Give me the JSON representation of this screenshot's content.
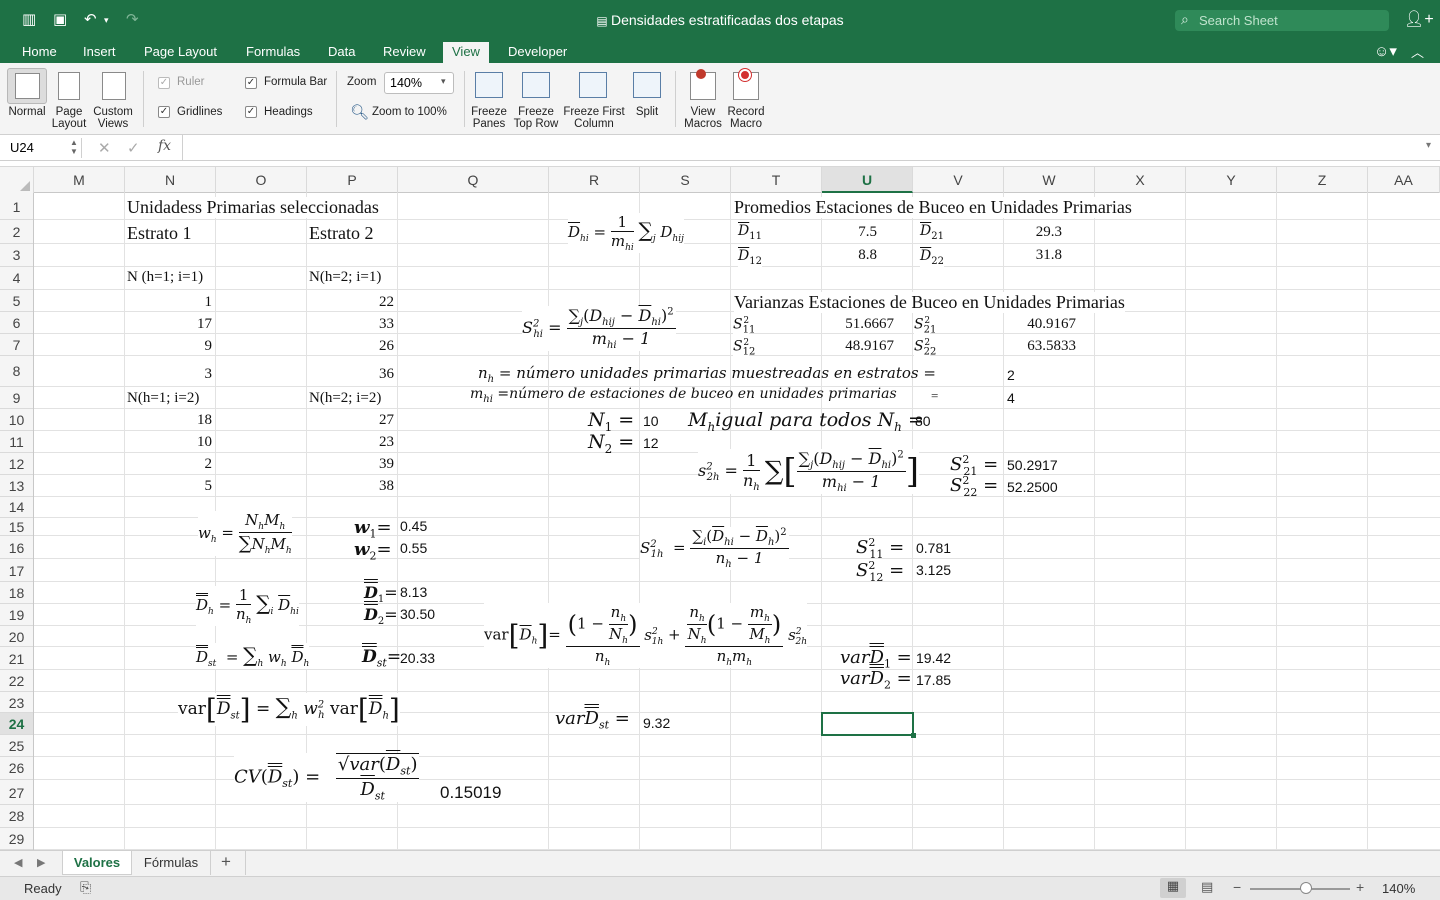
{
  "app": {
    "title": "Densidades estratificadas dos etapas",
    "search_placeholder": "Search Sheet",
    "accent": "#1e7145"
  },
  "ribbon_tabs": [
    "Home",
    "Insert",
    "Page Layout",
    "Formulas",
    "Data",
    "Review",
    "View",
    "Developer"
  ],
  "active_tab": "View",
  "ribbon": {
    "normal": "Normal",
    "page_layout": [
      "Page",
      "Layout"
    ],
    "custom_views": [
      "Custom",
      "Views"
    ],
    "ruler": "Ruler",
    "formula_bar": "Formula Bar",
    "gridlines": "Gridlines",
    "headings": "Headings",
    "zoom_label": "Zoom",
    "zoom_value": "140%",
    "zoom_100": "Zoom to 100%",
    "freeze_panes": [
      "Freeze",
      "Panes"
    ],
    "freeze_top_row": [
      "Freeze",
      "Top Row"
    ],
    "freeze_first_column": [
      "Freeze First",
      "Column"
    ],
    "split": "Split",
    "view_macros": [
      "View",
      "Macros"
    ],
    "record_macro": [
      "Record",
      "Macro"
    ]
  },
  "formula_bar": {
    "name_box": "U24",
    "fx": "fx",
    "content": ""
  },
  "columns": [
    "M",
    "N",
    "O",
    "P",
    "Q",
    "R",
    "S",
    "T",
    "U",
    "V",
    "W",
    "X",
    "Y",
    "Z",
    "AA"
  ],
  "selected_column": "U",
  "rows": [
    "1",
    "2",
    "3",
    "4",
    "5",
    "6",
    "7",
    "8",
    "9",
    "10",
    "11",
    "12",
    "13",
    "14",
    "15",
    "16",
    "17",
    "18",
    "19",
    "20",
    "21",
    "22",
    "23",
    "24",
    "25",
    "26",
    "27",
    "28",
    "29"
  ],
  "selected_row": "24",
  "cells": {
    "n1": "Unidadess Primarias seleccionadas",
    "n2": "Estrato 1",
    "p2": "Estrato 2",
    "n4": "N (h=1; i=1)",
    "p4": "N(h=2; i=1)",
    "n5": "1",
    "p5": "22",
    "n6": "17",
    "p6": "33",
    "n7": "9",
    "p7": "26",
    "n8": "3",
    "p8": "36",
    "n9": "N(h=1; i=2)",
    "p9": "N(h=2; i=2)",
    "n10": "18",
    "p10": "27",
    "n11": "10",
    "p11": "23",
    "n12": "2",
    "p12": "39",
    "n13": "5",
    "p13": "38",
    "t1": "Promedios Estaciones de Buceo en Unidades Primarias",
    "u2": "7.5",
    "w2": "29.3",
    "u3": "8.8",
    "w3": "31.8",
    "t5": "Varianzas Estaciones de Buceo en Unidades Primarias",
    "u6": "51.6667",
    "w6": "40.9167",
    "u7": "48.9167",
    "w7": "63.5833",
    "nh_text": "= número unidades primarias muestreadas en estratos =",
    "mhi_text": "=número de estaciones de buceo en unidades primarias",
    "eq_sign": "=",
    "w8": "2",
    "w9": "4",
    "s10": "10",
    "s11": "12",
    "mh_text": "igual para todos",
    "u10": "80",
    "w12": "50.2917",
    "w13": "52.2500",
    "p15": "0.45",
    "p16": "0.55",
    "u16": "0.781",
    "u17": "3.125",
    "p18": "8.13",
    "p19": "30.50",
    "p21": "20.33",
    "u21": "19.42",
    "u22": "17.85",
    "s24": "9.32",
    "cv": "0.15019",
    "var_label": "var",
    "cv_label": "CV"
  },
  "sheets": [
    "Valores",
    "Fórmulas"
  ],
  "active_sheet": "Valores",
  "status": {
    "ready": "Ready",
    "zoom": "140%"
  }
}
